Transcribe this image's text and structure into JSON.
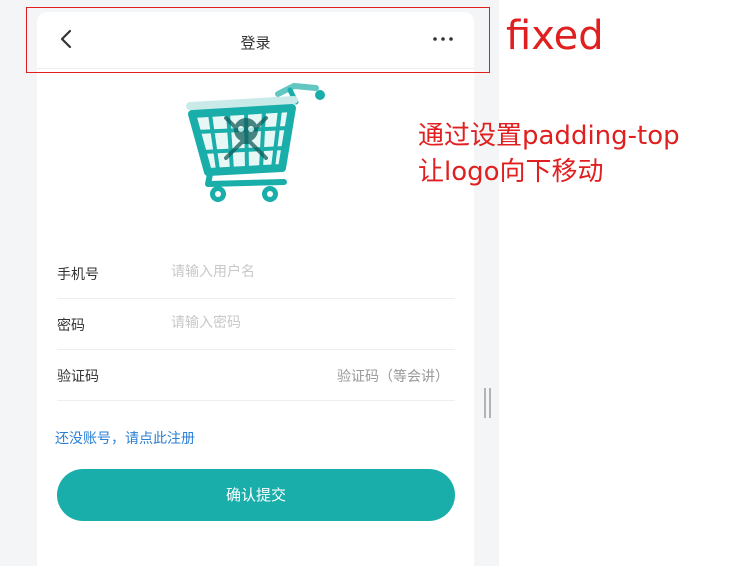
{
  "navbar": {
    "title": "登录",
    "back_icon": "chevron-left-icon",
    "more_icon": "more-dots-icon"
  },
  "logo": {
    "icon": "shopping-cart-skull-icon",
    "color": "#1aaeab"
  },
  "form": {
    "phone": {
      "label": "手机号",
      "placeholder": "请输入用户名"
    },
    "password": {
      "label": "密码",
      "placeholder": "请输入密码"
    },
    "code": {
      "label": "验证码",
      "button": "验证码（等会讲）"
    }
  },
  "register_link": "还没账号，请点此注册",
  "submit_label": "确认提交",
  "annotations": {
    "fixed_label": "fixed",
    "note_line1": "通过设置padding-top",
    "note_line2": "让logo向下移动",
    "color": "#e02020"
  },
  "colors": {
    "accent": "#1aaeab",
    "link": "#2a7fd4"
  }
}
